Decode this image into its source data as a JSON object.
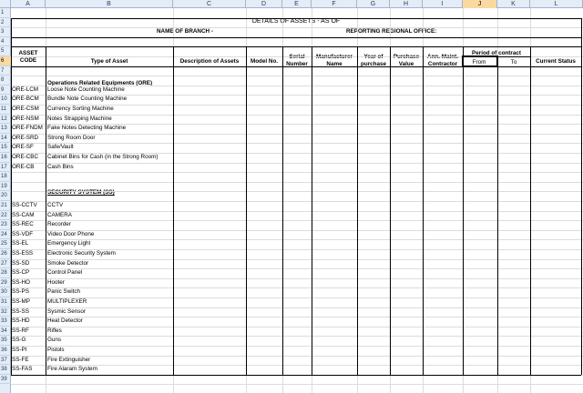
{
  "columns": [
    "A",
    "B",
    "C",
    "D",
    "E",
    "F",
    "G",
    "H",
    "I",
    "J",
    "K",
    "L"
  ],
  "rows": [
    "1",
    "2",
    "3",
    "4",
    "5",
    "6",
    "7",
    "8",
    "9",
    "10",
    "11",
    "12",
    "13",
    "14",
    "15",
    "16",
    "17",
    "18",
    "19",
    "20",
    "21",
    "22",
    "23",
    "24",
    "25",
    "26",
    "27",
    "28",
    "29",
    "30",
    "31",
    "32",
    "33",
    "34",
    "35",
    "36",
    "37",
    "38",
    "39"
  ],
  "title": "DETAILS OF ASSETS - AS OF",
  "branch_label": "NAME OF BRANCH -",
  "office_label": "REPORTING REGIONAL OFFICE:",
  "headers": {
    "asset_code": "ASSET CODE",
    "type_of_asset": "Type of Asset",
    "description": "Description of Assets",
    "model_no": "Model No.",
    "serial_number": "Serial Number",
    "manufacturer_name": "Manufacturer Name",
    "year_of_purchase": "Year of purchase",
    "purchase_value": "Purchase Value",
    "ann_maint_contractor": "Ann. Maint. Contractor",
    "period_of_contract": "Period of contract",
    "from": "From",
    "to": "To",
    "current_status": "Current Status"
  },
  "sections": {
    "ore_title": "Operations Related Equipments (ORE)",
    "ss_title": "SECURITY SYSTEM (SS)"
  },
  "ore_items": [
    {
      "code": "ORE-LCM",
      "name": "Loose Note Counting Machine"
    },
    {
      "code": "ORE-BCM",
      "name": "Bundle Note Counting Machine"
    },
    {
      "code": "ORE-CSM",
      "name": "Currency Sorting Machine"
    },
    {
      "code": "ORE-NSM",
      "name": "Notes Strapping Machine"
    },
    {
      "code": "ORE-FNDM",
      "name": "Fake Notes Detecting Machine"
    },
    {
      "code": "ORE-SRD",
      "name": "Strong Room Door"
    },
    {
      "code": "ORE-SF",
      "name": "Safe/Vault"
    },
    {
      "code": "ORE-CBC",
      "name": "Cabinet Bins for Cash (in the Strong Room)"
    },
    {
      "code": "ORE-CB",
      "name": "Cash Bins"
    }
  ],
  "ss_items": [
    {
      "code": "SS-CCTV",
      "name": "CCTV"
    },
    {
      "code": "SS-CAM",
      "name": "CAMERA"
    },
    {
      "code": "SS-REC",
      "name": "Recorder"
    },
    {
      "code": "SS-VDF",
      "name": "Video Door Phone"
    },
    {
      "code": "SS-EL",
      "name": "Emergency Light"
    },
    {
      "code": "SS-ESS",
      "name": "Electronic Security System"
    },
    {
      "code": "SS-SD",
      "name": "Smoke Detector"
    },
    {
      "code": "SS-CP",
      "name": "Control Panel"
    },
    {
      "code": "SS-HO",
      "name": "Hooter"
    },
    {
      "code": "SS-PS",
      "name": "Panic Switch"
    },
    {
      "code": "SS-MP",
      "name": "MULTIPLEXER"
    },
    {
      "code": "SS-SS",
      "name": "Sysmic Sensor"
    },
    {
      "code": "SS-HD",
      "name": "Heat Detector"
    },
    {
      "code": "SS-RF",
      "name": "Rifles"
    },
    {
      "code": "SS-G",
      "name": "Guns"
    },
    {
      "code": "SS-PI",
      "name": "Pistols"
    },
    {
      "code": "SS-FE",
      "name": "Fire Extinguisher"
    },
    {
      "code": "SS-FAS",
      "name": "Fire Alaram System"
    }
  ],
  "selection": {
    "column": "J",
    "row": "6"
  }
}
